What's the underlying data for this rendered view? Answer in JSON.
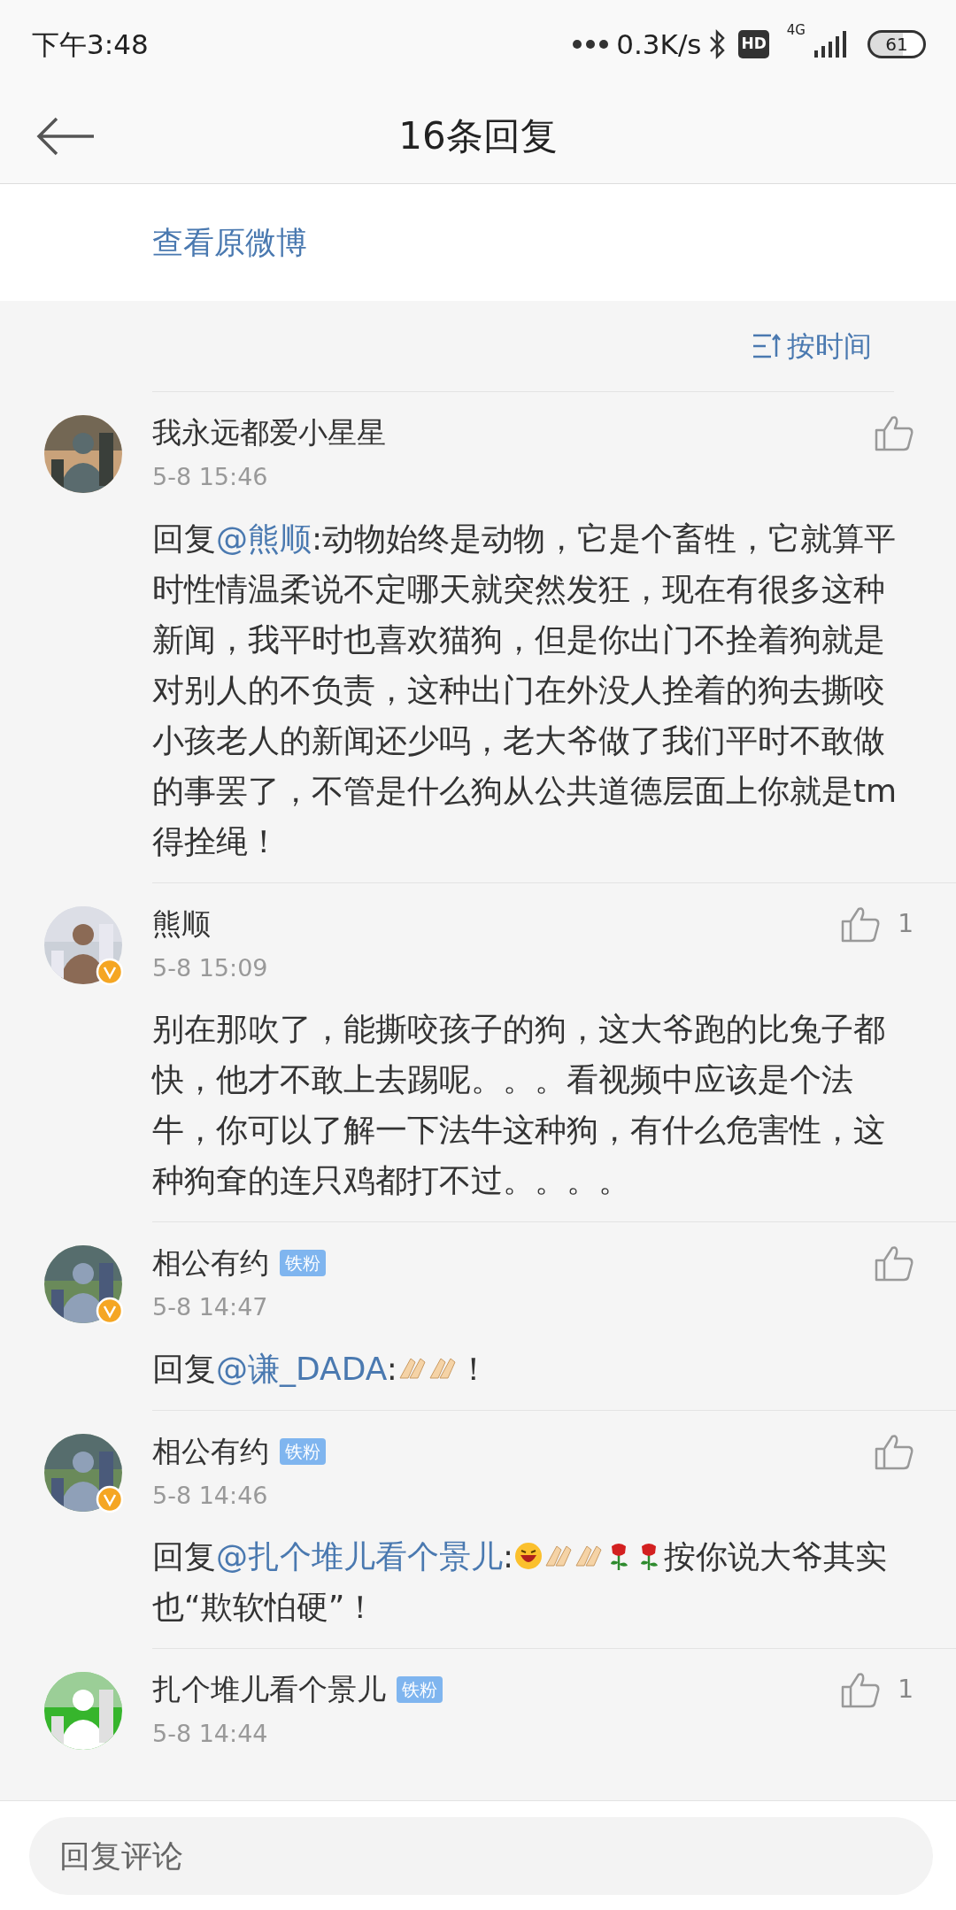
{
  "status_bar": {
    "time": "下午3:48",
    "network_speed": "0.3K/s",
    "hd": "HD",
    "network_type": "4G",
    "battery": "61"
  },
  "header": {
    "title": "16条回复"
  },
  "original_post_link": "查看原微博",
  "sort": {
    "label": "按时间"
  },
  "comments": [
    {
      "user": "我永远都爱小星星",
      "verified": false,
      "time": "5-8 15:46",
      "body": [
        {
          "kind": "text",
          "text": "回复"
        },
        {
          "kind": "mention",
          "text": "@熊顺"
        },
        {
          "kind": "text",
          "text": ":动物始终是动物，它是个畜牲，它就算平时性情温柔说不定哪天就突然发狂，现在有很多这种新闻，我平时也喜欢猫狗，但是你出门不拴着狗就是对别人的不负责，这种出门在外没人拴着的狗去撕咬小孩老人的新闻还少吗，老大爷做了我们平时不敢做的事罢了，不管是什么狗从公共道德层面上你就是tm得拴绳！"
        }
      ]
    },
    {
      "user": "熊顺",
      "verified": true,
      "time": "5-8 15:09",
      "likes": "1",
      "body": [
        {
          "kind": "text",
          "text": "别在那吹了，能撕咬孩子的狗，这大爷跑的比兔子都快，他才不敢上去踢呢。。。看视频中应该是个法牛，你可以了解一下法牛这种狗，有什么危害性，这种狗耷的连只鸡都打不过。。。。"
        }
      ]
    },
    {
      "user": "相公有约",
      "badge": "铁粉",
      "verified": true,
      "time": "5-8 14:47",
      "body": [
        {
          "kind": "text",
          "text": "回复"
        },
        {
          "kind": "mention",
          "text": "@谦_DADA"
        },
        {
          "kind": "text",
          "text": ":"
        },
        {
          "kind": "hands"
        },
        {
          "kind": "hands"
        },
        {
          "kind": "text",
          "text": "！"
        }
      ]
    },
    {
      "user": "相公有约",
      "badge": "铁粉",
      "verified": true,
      "time": "5-8 14:46",
      "body": [
        {
          "kind": "text",
          "text": "回复"
        },
        {
          "kind": "mention",
          "text": "@扎个堆儿看个景儿"
        },
        {
          "kind": "text",
          "text": ":"
        },
        {
          "kind": "grin"
        },
        {
          "kind": "hands"
        },
        {
          "kind": "hands"
        },
        {
          "kind": "rose"
        },
        {
          "kind": "rose"
        },
        {
          "kind": "text",
          "text": "按你说大爷其实也“欺软怕硬”！"
        }
      ]
    },
    {
      "user": "扎个堆儿看个景儿",
      "badge": "铁粉",
      "verified": false,
      "time": "5-8 14:44",
      "likes": "1"
    }
  ],
  "reply_box": {
    "placeholder": "回复评论"
  }
}
